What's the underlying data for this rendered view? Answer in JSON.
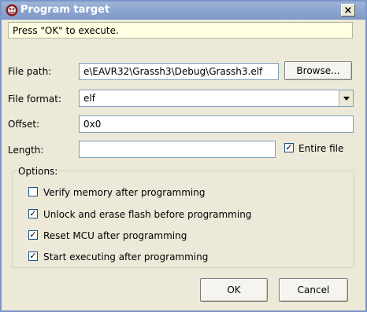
{
  "window": {
    "title": "Program target",
    "close_glyph": "×"
  },
  "message": "Press \"OK\" to execute.",
  "file_path": {
    "label": "File path:",
    "value": "e\\EAVR32\\Grassh3\\Debug\\Grassh3.elf",
    "browse_label": "Browse..."
  },
  "file_format": {
    "label": "File format:",
    "value": "elf"
  },
  "offset": {
    "label": "Offset:",
    "value": "0x0"
  },
  "length": {
    "label": "Length:",
    "value": "",
    "entire_file_label": "Entire file",
    "entire_file_checked": true
  },
  "options": {
    "legend": "Options:",
    "items": [
      {
        "label": "Verify memory after programming",
        "checked": false
      },
      {
        "label": "Unlock and erase flash before programming",
        "checked": true
      },
      {
        "label": "Reset MCU after programming",
        "checked": true
      },
      {
        "label": "Start executing after programming",
        "checked": true
      }
    ]
  },
  "buttons": {
    "ok": "OK",
    "cancel": "Cancel"
  },
  "icons": {
    "title": "app-logo-icon",
    "dropdown": "chevron-down-icon"
  },
  "colors": {
    "title_bar": "#8aa3cf",
    "message_bg": "#ffffe1",
    "dialog_bg": "#ece9d8"
  }
}
